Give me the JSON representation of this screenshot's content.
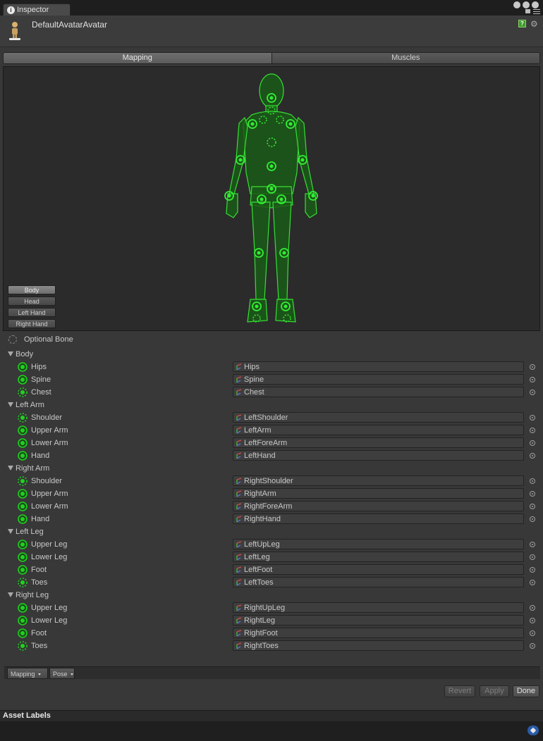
{
  "tab": {
    "label": "Inspector"
  },
  "header": {
    "title": "DefaultAvatarAvatar"
  },
  "mode_toggle": {
    "items": [
      "Mapping",
      "Muscles"
    ],
    "active": "Mapping"
  },
  "view_buttons": {
    "items": [
      "Body",
      "Head",
      "Left Hand",
      "Right Hand"
    ],
    "active": "Body"
  },
  "legend": {
    "label": "Optional Bone"
  },
  "groups": [
    {
      "title": "Body",
      "bones": [
        {
          "name": "Hips",
          "value": "Hips",
          "optional": false
        },
        {
          "name": "Spine",
          "value": "Spine",
          "optional": false
        },
        {
          "name": "Chest",
          "value": "Chest",
          "optional": true
        }
      ]
    },
    {
      "title": "Left Arm",
      "bones": [
        {
          "name": "Shoulder",
          "value": "LeftShoulder",
          "optional": true
        },
        {
          "name": "Upper Arm",
          "value": "LeftArm",
          "optional": false
        },
        {
          "name": "Lower Arm",
          "value": "LeftForeArm",
          "optional": false
        },
        {
          "name": "Hand",
          "value": "LeftHand",
          "optional": false
        }
      ]
    },
    {
      "title": "Right Arm",
      "bones": [
        {
          "name": "Shoulder",
          "value": "RightShoulder",
          "optional": true
        },
        {
          "name": "Upper Arm",
          "value": "RightArm",
          "optional": false
        },
        {
          "name": "Lower Arm",
          "value": "RightForeArm",
          "optional": false
        },
        {
          "name": "Hand",
          "value": "RightHand",
          "optional": false
        }
      ]
    },
    {
      "title": "Left Leg",
      "bones": [
        {
          "name": "Upper Leg",
          "value": "LeftUpLeg",
          "optional": false
        },
        {
          "name": "Lower Leg",
          "value": "LeftLeg",
          "optional": false
        },
        {
          "name": "Foot",
          "value": "LeftFoot",
          "optional": false
        },
        {
          "name": "Toes",
          "value": "LeftToes",
          "optional": true
        }
      ]
    },
    {
      "title": "Right Leg",
      "bones": [
        {
          "name": "Upper Leg",
          "value": "RightUpLeg",
          "optional": false
        },
        {
          "name": "Lower Leg",
          "value": "RightLeg",
          "optional": false
        },
        {
          "name": "Foot",
          "value": "RightFoot",
          "optional": false
        },
        {
          "name": "Toes",
          "value": "RightToes",
          "optional": true
        }
      ]
    }
  ],
  "bottom_bar": {
    "mapping_label": "Mapping",
    "pose_label": "Pose"
  },
  "actions": {
    "revert": "Revert",
    "apply": "Apply",
    "done": "Done"
  },
  "asset_labels": {
    "title": "Asset Labels"
  },
  "colors": {
    "bone_green": "#1fd11f",
    "panel": "#383838",
    "viewport": "#2b2b2b"
  },
  "icons": {
    "tab": "info-icon",
    "help": "help-icon",
    "settings": "gear-icon",
    "tag": "tag-icon",
    "lock": "lock-icon",
    "menu": "menu-icon"
  }
}
